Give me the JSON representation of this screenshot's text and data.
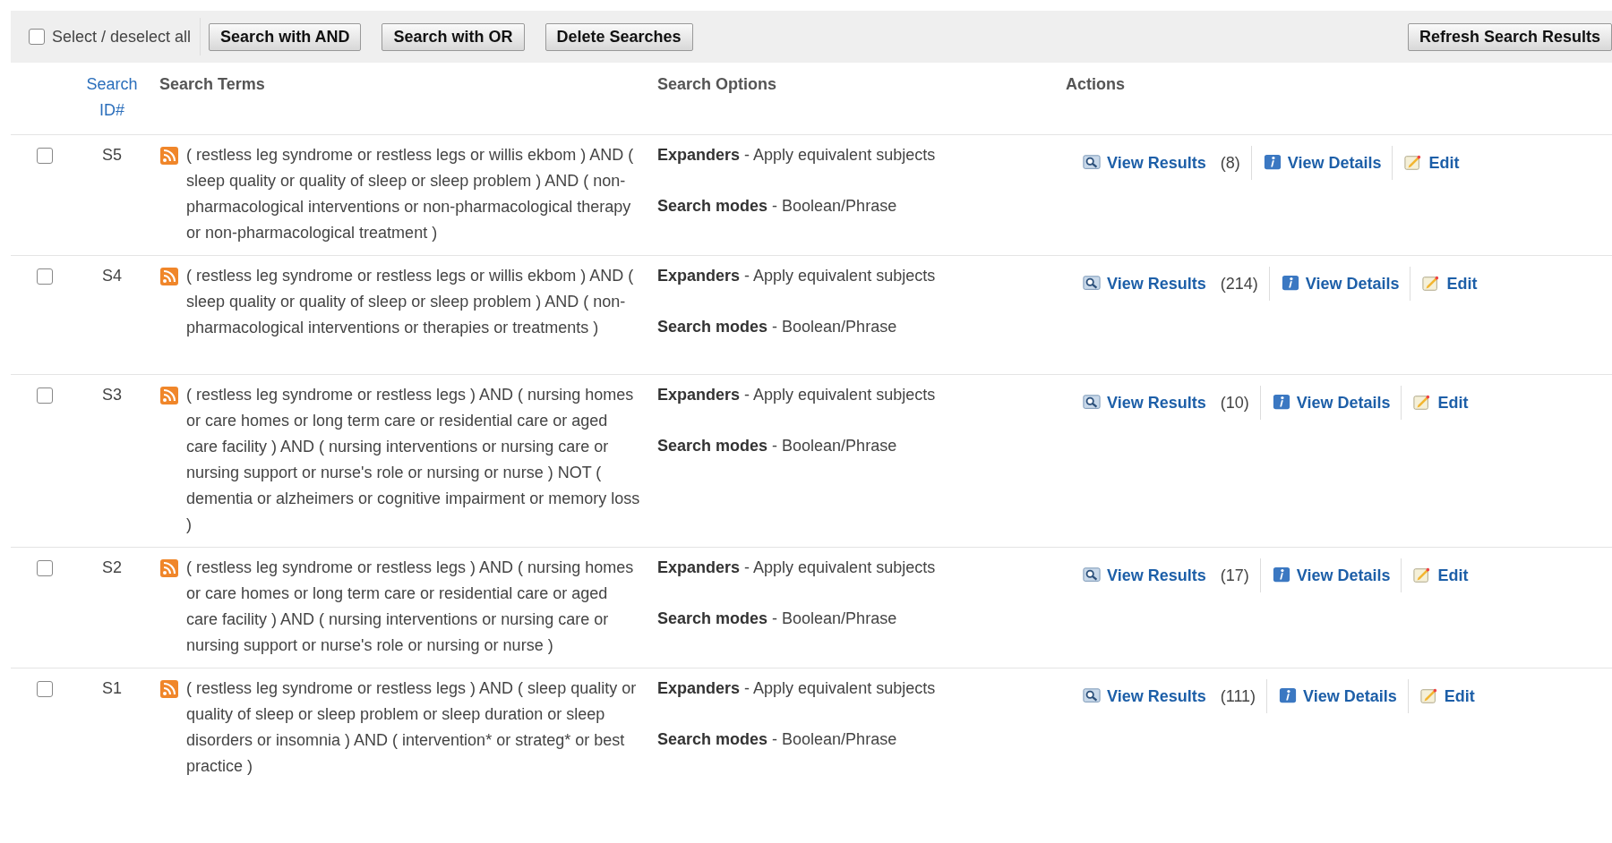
{
  "toolbar": {
    "select_all": {
      "label": "Select / deselect all",
      "checked": false
    },
    "buttons": [
      "Search with AND",
      "Search with OR",
      "Delete Searches"
    ],
    "refresh_button": "Refresh Search Results"
  },
  "columns": {
    "id": "Search ID#",
    "terms": "Search Terms",
    "options": "Search Options",
    "actions": "Actions"
  },
  "rows": [
    {
      "checked": false,
      "id": "S5",
      "terms": "( restless leg syndrome or restless legs or willis ekbom ) AND ( sleep quality or quality of sleep or sleep problem ) AND ( non-pharmacological interventions or non-pharmacological therapy or non-pharmacological treatment )",
      "options": [
        {
          "label": "Expanders",
          "value": " - Apply equivalent subjects"
        },
        {
          "label": "Search modes",
          "value": " - Boolean/Phrase"
        }
      ],
      "view_results": "View Results",
      "count": "(8)",
      "view_details": "View Details",
      "edit": "Edit"
    },
    {
      "checked": false,
      "id": "S4",
      "terms": "( restless leg syndrome or restless legs or willis ekbom ) AND ( sleep quality or quality of sleep or sleep problem ) AND ( non-pharmacological interventions or therapies or treatments )",
      "options": [
        {
          "label": "Expanders",
          "value": " - Apply equivalent subjects"
        },
        {
          "label": "Search modes",
          "value": " - Boolean/Phrase"
        }
      ],
      "view_results": "View Results",
      "count": "(214)",
      "view_details": "View Details",
      "edit": "Edit"
    },
    {
      "checked": false,
      "id": "S3",
      "terms": "( restless leg syndrome or restless legs ) AND ( nursing homes or care homes or long term care or residential care or aged care facility ) AND ( nursing interventions or nursing care or nursing support or nurse's role or nursing or nurse ) NOT ( dementia or alzheimers or cognitive impairment or memory loss )",
      "options": [
        {
          "label": "Expanders",
          "value": " - Apply equivalent subjects"
        },
        {
          "label": "Search modes",
          "value": " - Boolean/Phrase"
        }
      ],
      "view_results": "View Results",
      "count": "(10)",
      "view_details": "View Details",
      "edit": "Edit"
    },
    {
      "checked": false,
      "id": "S2",
      "terms": "( restless leg syndrome or restless legs ) AND ( nursing homes or care homes or long term care or residential care or aged care facility ) AND ( nursing interventions or nursing care or nursing support or nurse's role or nursing or nurse )",
      "options": [
        {
          "label": "Expanders",
          "value": " - Apply equivalent subjects"
        },
        {
          "label": "Search modes",
          "value": " - Boolean/Phrase"
        }
      ],
      "view_results": "View Results",
      "count": "(17)",
      "view_details": "View Details",
      "edit": "Edit"
    },
    {
      "checked": false,
      "id": "S1",
      "terms": "( restless leg syndrome or restless legs ) AND ( sleep quality or quality of sleep or sleep problem or sleep duration or sleep disorders or insomnia ) AND ( intervention* or strateg* or best practice )",
      "options": [
        {
          "label": "Expanders",
          "value": " - Apply equivalent subjects"
        },
        {
          "label": "Search modes",
          "value": " - Boolean/Phrase"
        }
      ],
      "view_results": "View Results",
      "count": "(111)",
      "view_details": "View Details",
      "edit": "Edit"
    }
  ]
}
